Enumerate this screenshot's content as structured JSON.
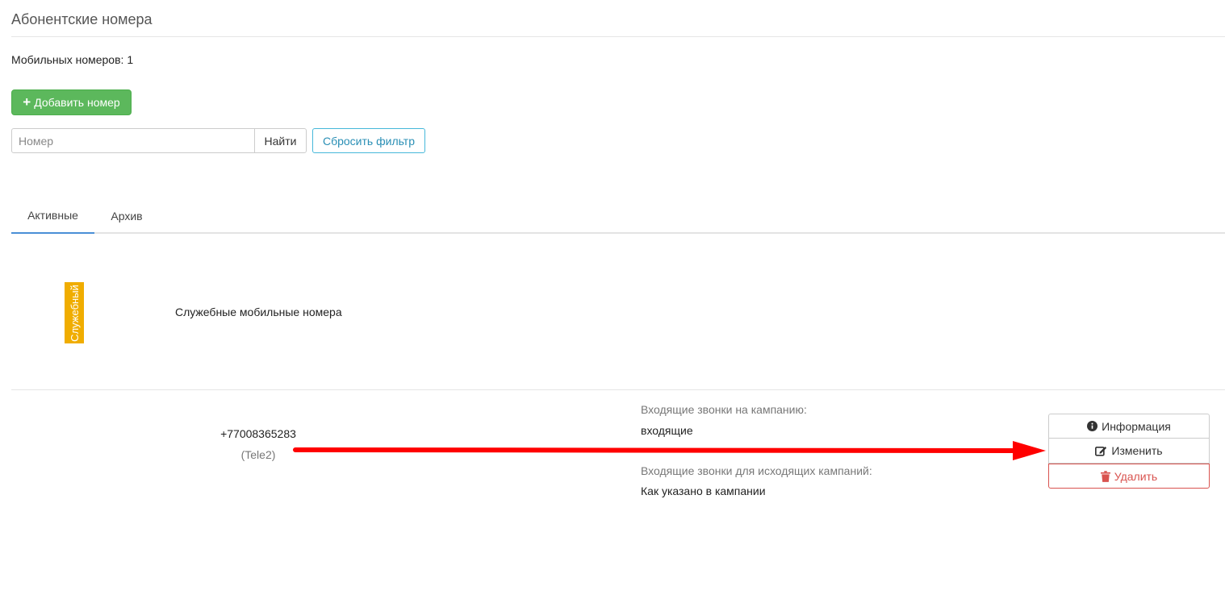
{
  "page": {
    "title": "Абонентские номера"
  },
  "summary": {
    "mobile_count_label": "Мобильных номеров:",
    "mobile_count_value": "1"
  },
  "toolbar": {
    "add_icon": "plus-icon",
    "add_label": "Добавить номер"
  },
  "filter": {
    "placeholder": "Номер",
    "value": "",
    "find_label": "Найти",
    "reset_label": "Сбросить фильтр"
  },
  "tabs": [
    {
      "label": "Активные",
      "active": true
    },
    {
      "label": "Архив",
      "active": false
    }
  ],
  "group": {
    "badge_label": "Служебный",
    "badge_color": "#f0ad00",
    "title": "Служебные мобильные номера"
  },
  "number_row": {
    "phone": "+77008365283",
    "operator": "(Tele2)",
    "incoming_label": "Входящие звонки на кампанию:",
    "incoming_value": "входящие",
    "outgoing_label": "Входящие звонки для исходящих кампаний:",
    "outgoing_value": "Как указано в кампании"
  },
  "actions": {
    "info_icon": "info-circle-icon",
    "info_label": "Информация",
    "edit_icon": "edit-icon",
    "edit_label": "Изменить",
    "delete_icon": "trash-icon",
    "delete_label": "Удалить"
  },
  "annotation": {
    "arrow_color": "#ff0000"
  },
  "colors": {
    "success": "#5cb85c",
    "info_outline": "#46b8da",
    "danger": "#d9534f",
    "tab_active": "#4a8fd6"
  }
}
